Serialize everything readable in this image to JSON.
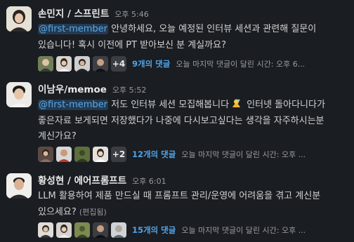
{
  "messages": [
    {
      "author": "손민지 / 스프린트",
      "time": "오후 5:46",
      "mention": "@first-member",
      "text": " 안녕하세요, 오늘 예정된 인터뷰 세션과 관련해 질문이 있습니다! 혹시 이전에 PT 받아보신 분 계실까요?",
      "thread": {
        "extra": "+4",
        "replies": "9개의 댓글",
        "last_reply": "오늘 마지막 댓글이 달린 시간: 오후 6..."
      }
    },
    {
      "author": "이남우/memoe",
      "time": "오후 5:52",
      "mention": "@first-member",
      "text_before_emoji": " 저도 인터뷰 세션 모집해봅니다",
      "emoji": "sweat-emoji",
      "text_after_emoji": " 인터넷 돌아다니다가 좋은자료 보게되면 저장했다가 나중에 다시보고싶다는 생각을 자주하시는분 계신가요?",
      "thread": {
        "extra": "+2",
        "replies": "12개의 댓글",
        "last_reply": "오늘 마지막 댓글이 달린 시간: 오후 ..."
      }
    },
    {
      "author": "황성현 / 에어프롬프트",
      "time": "오후 6:01",
      "text": "LLM 활용하여 제품 만드실 때 프롬프트 관리/운영에 어려움을 겪고 계신분 있으세요?",
      "edited": "(편집됨)",
      "thread": {
        "replies": "15개의 댓글",
        "last_reply": "오늘 마지막 댓글이 달린 시간: 오후 ..."
      }
    }
  ],
  "colors": {
    "background": "#1a1d21",
    "mention_bg": "#233a52",
    "mention_text": "#5aa9e6",
    "reply_link": "#4fa3e8"
  }
}
